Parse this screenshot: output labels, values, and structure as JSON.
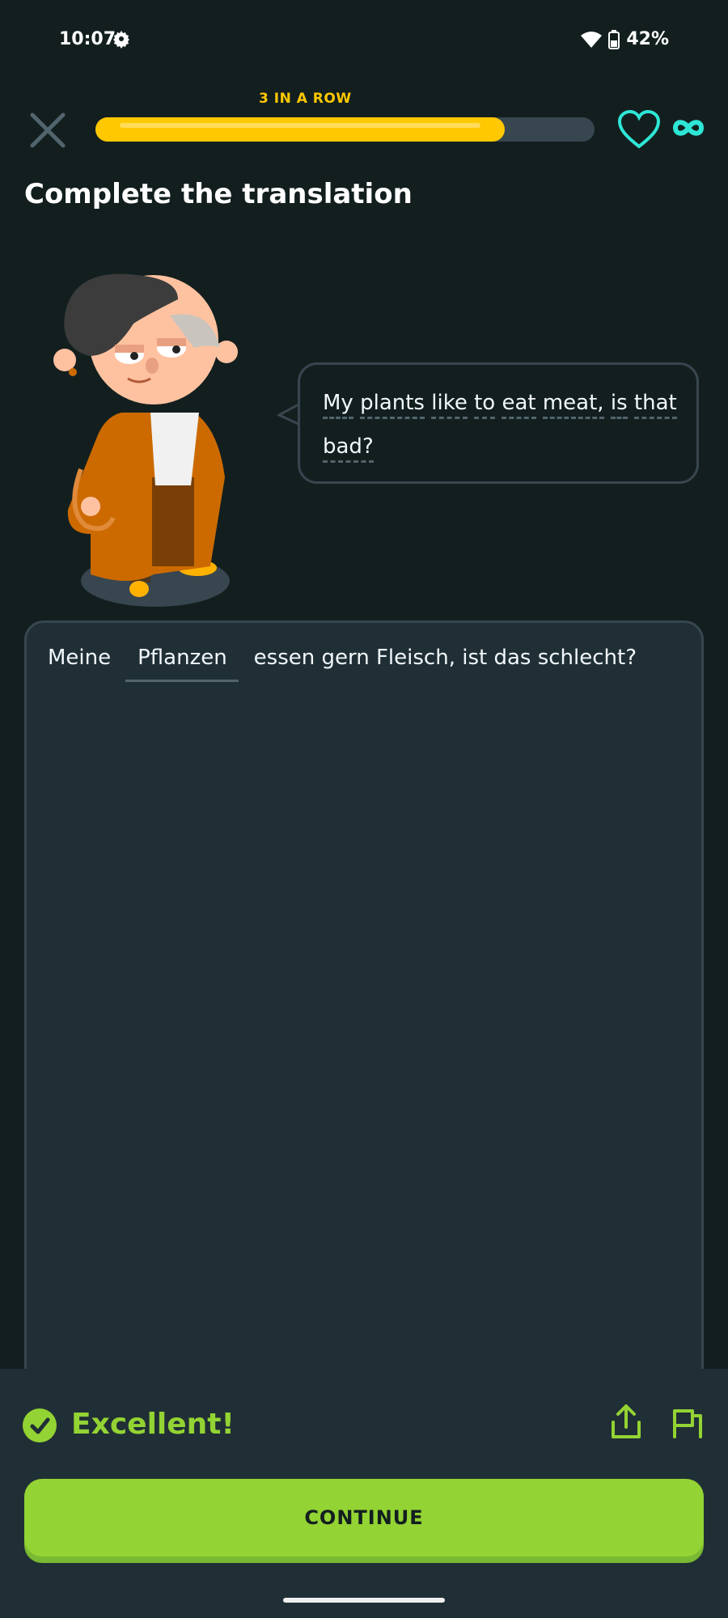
{
  "status_bar": {
    "time": "10:07",
    "battery": "42%"
  },
  "header": {
    "streak_label": "3 IN A ROW",
    "progress_fraction": 0.82,
    "hearts": "∞"
  },
  "prompt": {
    "title": "Complete the translation"
  },
  "bubble": {
    "words": [
      "My",
      "plants",
      "like",
      "to",
      "eat",
      "meat,",
      "is",
      "that",
      "bad?"
    ]
  },
  "answer": {
    "prefix": "Meine",
    "filled": "Pflanzen",
    "suffix": "essen gern Fleisch, ist das schlecht?"
  },
  "feedback": {
    "title": "Excellent!",
    "continue_label": "CONTINUE"
  },
  "colors": {
    "accent_green": "#93d333",
    "streak_yellow": "#ffc800",
    "heart_cyan": "#2ee6d6"
  }
}
